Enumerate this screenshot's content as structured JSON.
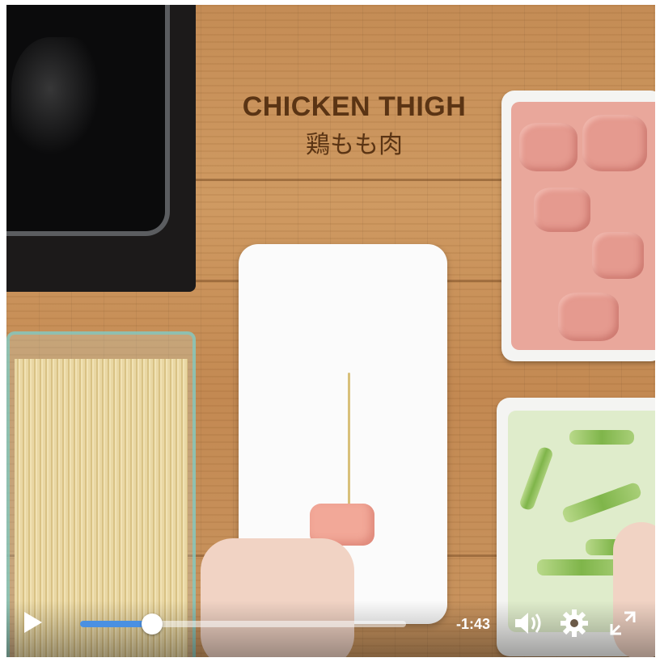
{
  "overlay": {
    "title": "CHICKEN THIGH",
    "subtitle": "鶏もも肉"
  },
  "player": {
    "play_icon": "play-icon",
    "progress": 0.22,
    "time_remaining": "-1:43",
    "volume_icon": "volume-icon",
    "settings_icon": "gear-icon",
    "fullscreen_icon": "expand-icon"
  },
  "colors": {
    "accent": "#4a90e2",
    "title": "#5a3414"
  }
}
